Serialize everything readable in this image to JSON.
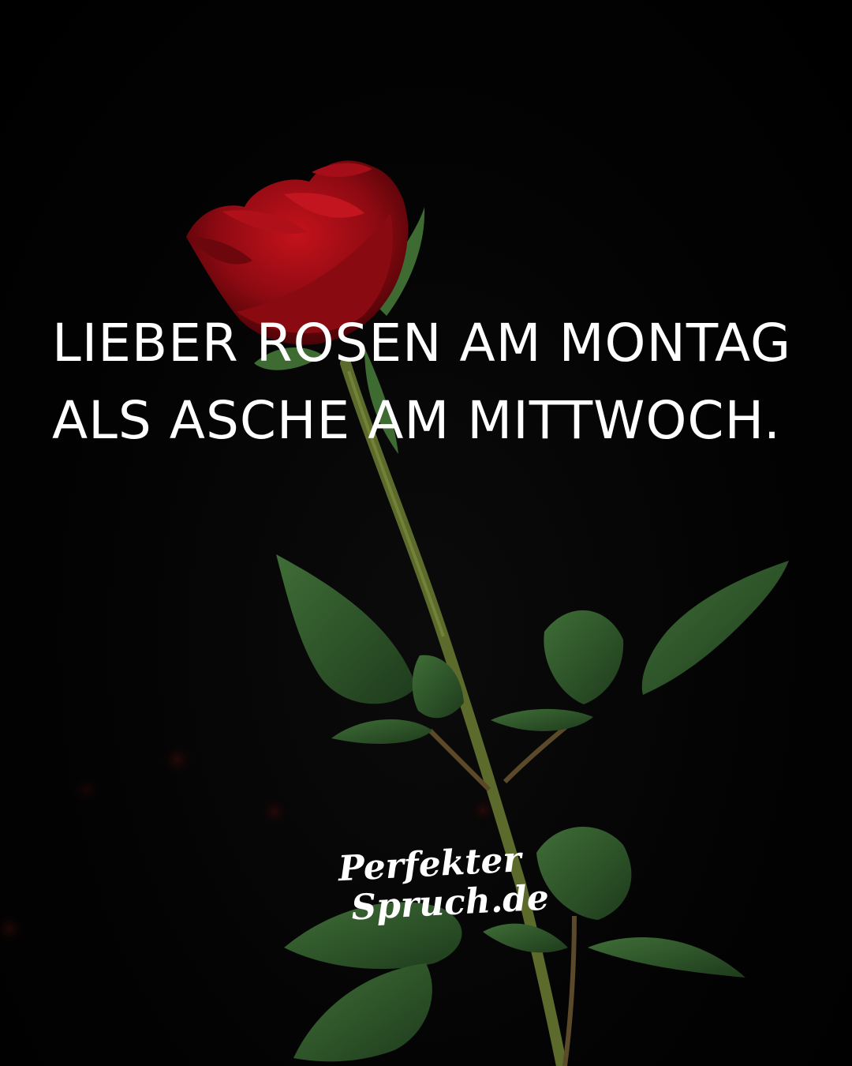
{
  "quote": {
    "line1": "LIEBER ROSEN AM MONTAG",
    "line2": "ALS ASCHE AM MITTWOCH."
  },
  "brand": {
    "line1": "Perfekter",
    "line2": "Spruch.de"
  },
  "colors": {
    "background": "#000000",
    "text": "#ffffff",
    "rose": "#9e0b12",
    "leaf": "#2f5a2c",
    "stem": "#5a6a2a"
  }
}
